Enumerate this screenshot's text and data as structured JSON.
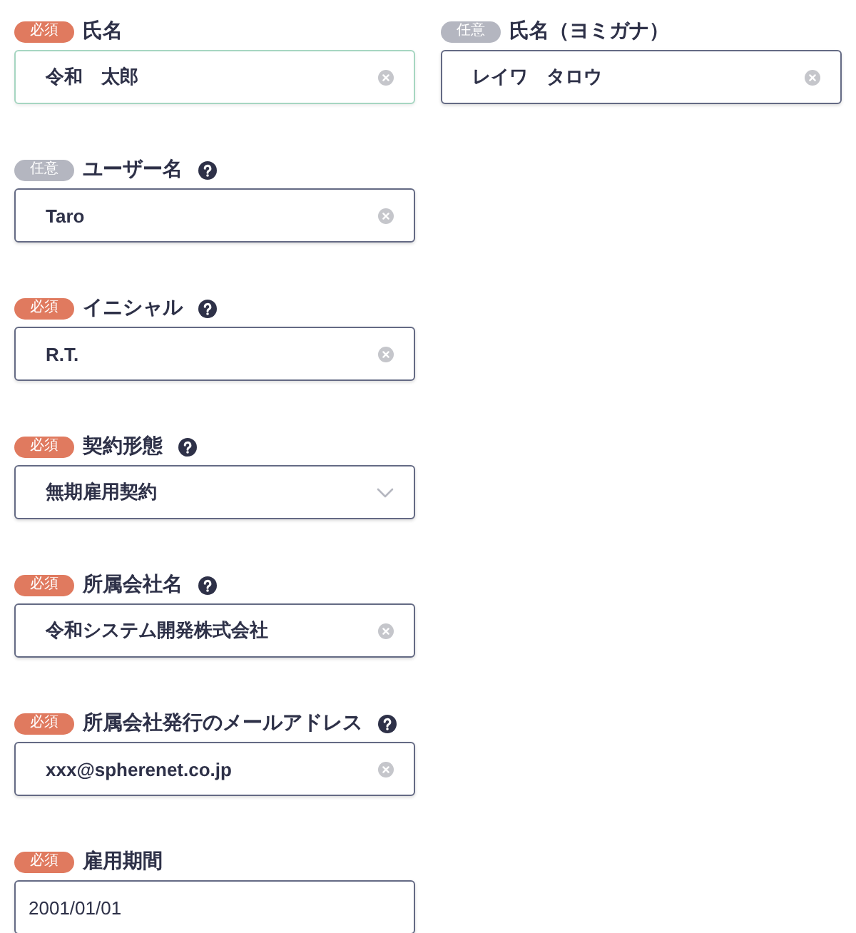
{
  "rows": [
    [
      {
        "badge": "必須",
        "required": true,
        "label": "氏名",
        "help": false,
        "kind": "text",
        "value": "令和　太郎",
        "focused": true
      },
      {
        "badge": "任意",
        "required": false,
        "label": "氏名（ヨミガナ）",
        "help": false,
        "kind": "text",
        "value": "レイワ　タロウ",
        "focused": false
      }
    ],
    [
      {
        "badge": "任意",
        "required": false,
        "label": "ユーザー名",
        "help": true,
        "kind": "text",
        "value": "Taro",
        "focused": false
      }
    ],
    [
      {
        "badge": "必須",
        "required": true,
        "label": "イニシャル",
        "help": true,
        "kind": "text",
        "value": "R.T.",
        "focused": false
      }
    ],
    [
      {
        "badge": "必須",
        "required": true,
        "label": "契約形態",
        "help": true,
        "kind": "select",
        "value": "無期雇用契約",
        "focused": false
      }
    ],
    [
      {
        "badge": "必須",
        "required": true,
        "label": "所属会社名",
        "help": true,
        "kind": "text",
        "value": "令和システム開発株式会社",
        "focused": false
      }
    ],
    [
      {
        "badge": "必須",
        "required": true,
        "label": "所属会社発行のメールアドレス",
        "help": true,
        "kind": "text",
        "value": "xxx@spherenet.co.jp",
        "focused": false
      }
    ],
    [
      {
        "badge": "必須",
        "required": true,
        "label": "雇用期間",
        "help": false,
        "kind": "date",
        "value": "2001/01/01",
        "focused": false
      }
    ]
  ]
}
